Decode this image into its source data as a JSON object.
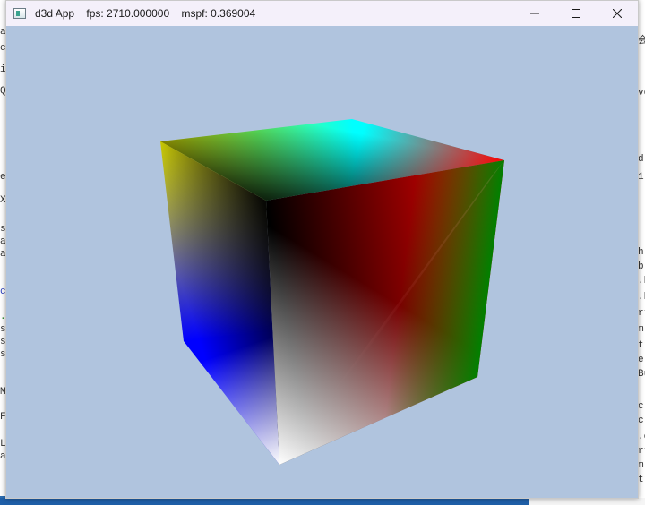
{
  "window": {
    "title": "d3d App    fps: 2710.000000    mspf: 0.369004",
    "minimize_icon": "minimize-icon",
    "maximize_icon": "maximize-icon",
    "close_icon": "close-icon",
    "app_icon": "app-window-icon"
  },
  "viewport": {
    "background_color": "#b0c4de",
    "object": "rotating-color-cube",
    "vertex_colors": {
      "top_left_front": "#ffff00",
      "top_back": "#00ffff",
      "top_right": "#ff0000",
      "center_front": "#000000",
      "left_bottom": "#0000ff",
      "right_bottom": "#008000",
      "bottom_front": "#ffffff"
    }
  },
  "background": {
    "left_fragments": [
      "a",
      "cl",
      "it",
      "Q",
      "(",
      "e (",
      "X)",
      "si",
      "at",
      "an",
      "co",
      ".c",
      "s*",
      "s*",
      "s*",
      "v",
      "M",
      "Fe",
      "LM",
      "an"
    ],
    "right_fragments": [
      "会",
      "ve",
      "ta",
      "d(",
      "1'",
      "h",
      "b.l",
      ".h",
      ".h",
      "rtu",
      "m",
      "tr",
      "elp",
      "Bu",
      "c",
      "c.",
      ".c",
      "rtu",
      "m",
      "tri",
      "ntr",
      "Geometr"
    ]
  }
}
